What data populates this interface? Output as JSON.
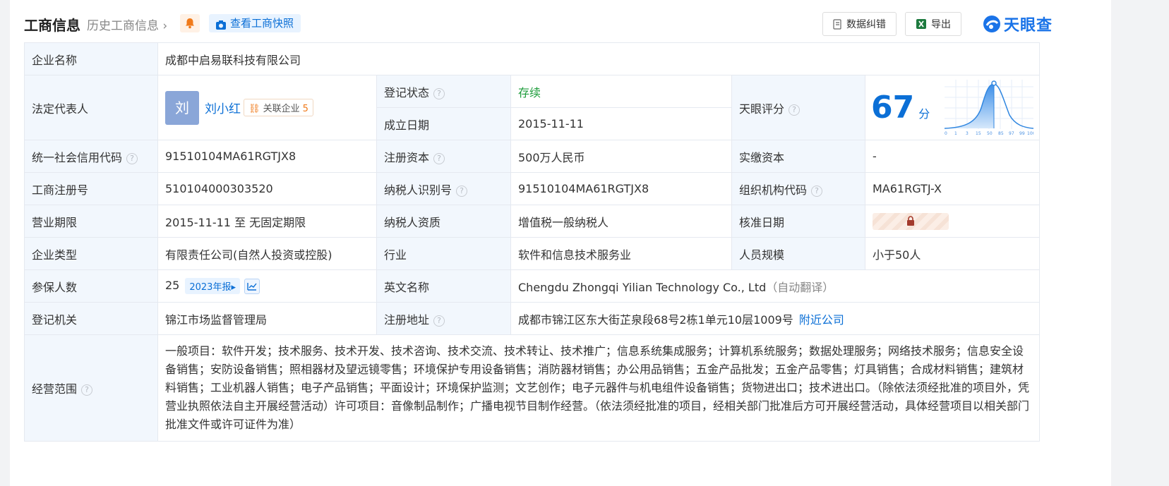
{
  "header": {
    "title": "工商信息",
    "history": "历史工商信息",
    "snapshot": "查看工商快照",
    "report_error": "数据纠错",
    "export": "导出",
    "logo_text": "天眼查"
  },
  "company": {
    "name_label": "企业名称",
    "name": "成都中启易联科技有限公司",
    "legal_rep_label": "法定代表人",
    "legal_rep_avatar": "刘",
    "legal_rep": "刘小红",
    "assoc_label": "关联企业",
    "assoc_count": "5",
    "reg_status_label": "登记状态",
    "reg_status": "存续",
    "found_date_label": "成立日期",
    "found_date": "2015-11-11",
    "score_label": "天眼评分",
    "score": "67",
    "score_unit": "分",
    "score_ticks": [
      "0",
      "1",
      "3",
      "15",
      "50",
      "85",
      "97",
      "99",
      "100"
    ],
    "credit_code_label": "统一社会信用代码",
    "credit_code": "91510104MA61RGTJX8",
    "reg_capital_label": "注册资本",
    "reg_capital": "500万人民币",
    "paid_capital_label": "实缴资本",
    "paid_capital": "-",
    "biz_reg_no_label": "工商注册号",
    "biz_reg_no": "510104000303520",
    "taxpayer_id_label": "纳税人识别号",
    "taxpayer_id": "91510104MA61RGTJX8",
    "org_code_label": "组织机构代码",
    "org_code": "MA61RGTJ-X",
    "term_label": "营业期限",
    "term": "2015-11-11 至 无固定期限",
    "tax_qual_label": "纳税人资质",
    "tax_qual": "增值税一般纳税人",
    "approve_date_label": "核准日期",
    "type_label": "企业类型",
    "type": "有限责任公司(自然人投资或控股)",
    "industry_label": "行业",
    "industry": "软件和信息技术服务业",
    "staff_label": "人员规模",
    "staff": "小于50人",
    "insured_label": "参保人数",
    "insured": "25",
    "insured_year": "2023年报",
    "en_name_label": "英文名称",
    "en_name": "Chengdu Zhongqi Yilian Technology Co., Ltd",
    "en_name_note": "（自动翻译）",
    "authority_label": "登记机关",
    "authority": "锦江市场监督管理局",
    "address_label": "注册地址",
    "address": "成都市锦江区东大街芷泉段68号2栋1单元10层1009号",
    "nearby": "附近公司",
    "scope_label": "经营范围",
    "scope": "一般项目：软件开发；技术服务、技术开发、技术咨询、技术交流、技术转让、技术推广；信息系统集成服务；计算机系统服务；数据处理服务；网络技术服务；信息安全设备销售；安防设备销售；照相器材及望远镜零售；环境保护专用设备销售；消防器材销售；办公用品销售；五金产品批发；五金产品零售；灯具销售；合成材料销售；建筑材料销售；工业机器人销售；电子产品销售；平面设计；环境保护监测；文艺创作；电子元器件与机电组件设备销售；货物进出口；技术进出口。（除依法须经批准的项目外，凭营业执照依法自主开展经营活动）许可项目：音像制品制作；广播电视节目制作经营。（依法须经批准的项目，经相关部门批准后方可开展经营活动，具体经营项目以相关部门批准文件或许可证件为准）"
  },
  "colors": {
    "accent": "#0b6fd6",
    "label_bg": "#f2f7fd",
    "status_green": "#1d9c3b",
    "orange": "#f07a1a"
  }
}
